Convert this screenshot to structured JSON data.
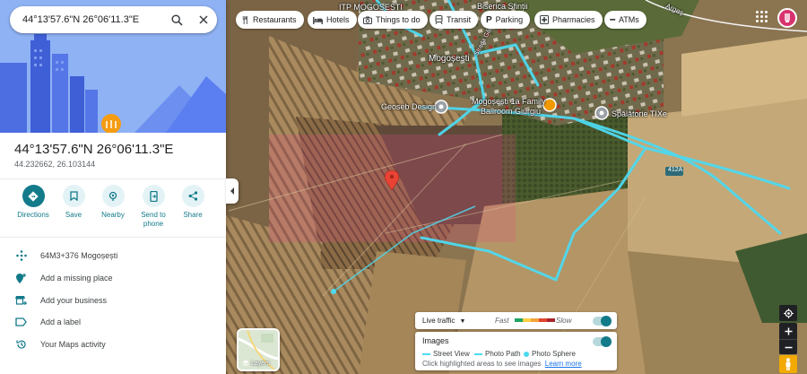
{
  "search": {
    "query": "44°13'57.6\"N 26°06'11.3\"E",
    "search_icon": "search-icon",
    "close_icon": "close-icon"
  },
  "place": {
    "title": "44°13'57.6\"N 26°06'11.3\"E",
    "coords": "44.232662, 26.103144"
  },
  "actions": [
    {
      "label": "Directions",
      "icon": "directions-icon"
    },
    {
      "label": "Save",
      "icon": "bookmark-icon"
    },
    {
      "label": "Nearby",
      "icon": "nearby-icon"
    },
    {
      "label": "Send to phone",
      "icon": "phone-icon"
    },
    {
      "label": "Share",
      "icon": "share-icon"
    }
  ],
  "details": [
    {
      "text": "64M3+376 Mogoșești",
      "icon": "plus-code-icon"
    },
    {
      "text": "Add a missing place",
      "icon": "add-place-icon"
    },
    {
      "text": "Add your business",
      "icon": "add-business-icon"
    },
    {
      "text": "Add a label",
      "icon": "label-icon"
    },
    {
      "text": "Your Maps activity",
      "icon": "history-icon"
    }
  ],
  "chips": [
    {
      "label": "Restaurants",
      "icon": "restaurant-icon"
    },
    {
      "label": "Hotels",
      "icon": "hotel-icon"
    },
    {
      "label": "Things to do",
      "icon": "camera-icon"
    },
    {
      "label": "Transit",
      "icon": "transit-icon"
    },
    {
      "label": "Parking",
      "icon": "parking-icon"
    },
    {
      "label": "Pharmacies",
      "icon": "pharmacy-icon"
    },
    {
      "label": "ATMs",
      "icon": "atm-icon"
    }
  ],
  "map_labels": {
    "itp": "ITP MOGOȘEȘTI",
    "biserica": "Biserica Sfinții",
    "village": "Mogoșești",
    "street": "Strada Gării",
    "geoseb": "Geoseb Design",
    "family_ballroom_1": "Mogoșești 1a Family",
    "family_ballroom_2": "Ballroom Giurgiu",
    "spalatorie": "Spălătorie TIXe",
    "road_number": "412A",
    "arges": "Argeș"
  },
  "layers": {
    "label": "Layers"
  },
  "traffic": {
    "label": "Live traffic",
    "fast": "Fast",
    "slow": "Slow",
    "enabled": true,
    "colors": [
      "#1ea362",
      "#ffcf44",
      "#f2a33a",
      "#e0452f",
      "#a6262a"
    ]
  },
  "images": {
    "title": "Images",
    "legend": [
      "Street View",
      "Photo Path",
      "Photo Sphere"
    ],
    "hint": "Click highlighted areas to see images",
    "learn_more": "Learn more",
    "enabled": true
  },
  "colors": {
    "accent": "#137a8a",
    "street_view_lines": "#4ed9f0",
    "pin": "#ea4335"
  }
}
